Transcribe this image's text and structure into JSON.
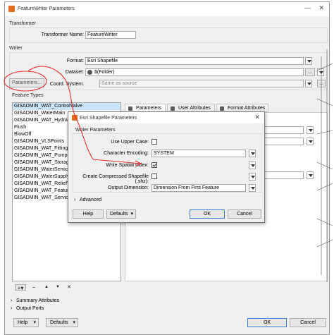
{
  "window": {
    "title": "FeatureWriter Parameters",
    "close_glyph": "✕",
    "min_glyph": "—"
  },
  "transformer": {
    "section_label": "Transformer",
    "name_label": "Transformer Name:",
    "name_value": "FeatureWriter"
  },
  "writer": {
    "section_label": "Writer",
    "format_label": "Format:",
    "format_value": "Esri Shapefile",
    "dataset_label": "Dataset:",
    "dataset_value": "$(Folder)",
    "dataset_browse": "...",
    "coord_label": "Coord. System:",
    "coord_placeholder": "Same as source",
    "parameters_button": "Parameters..."
  },
  "feature_types": {
    "section_label": "Feature Types",
    "items": [
      "GISADMIN_WAT_ControlValve",
      "GISADMIN_WaterMain",
      "GISADMIN_WAT_Hydrant",
      "Flush",
      "BlowOff",
      "GISADMIN_VLSPoints",
      "GISADMIN_WAT_Fittings",
      "GISADMIN_WAT_Pumps",
      "GISADMIN_WAT_Storage",
      "GISADMIN_WaterService",
      "GISADMIN_WaterSupply",
      "GISADMIN_WAT_ReliefV",
      "GISADMIN_WAT_Feature",
      "GISADMIN_WAT_Service"
    ],
    "toolbar": {
      "add": "+▾",
      "remove": "−",
      "up": "▲",
      "down": "▼",
      "clear": "✕"
    }
  },
  "tabs": [
    {
      "label": "Parameters",
      "icon": "gear-icon"
    },
    {
      "label": "User Attributes",
      "icon": "table-icon"
    },
    {
      "label": "Format Attributes",
      "icon": "table-icon"
    }
  ],
  "bottom": {
    "summary_attributes": "Summary Attributes",
    "output_ports": "Output Ports",
    "help": "Help",
    "defaults": "Defaults",
    "ok": "OK",
    "cancel": "Cancel"
  },
  "dialog": {
    "title": "Esri Shapefile Parameters",
    "group_label": "Writer Parameters",
    "fields": {
      "upper_case_label": "Use Upper Case:",
      "upper_case_checked": false,
      "encoding_label": "Character Encoding:",
      "encoding_value": "SYSTEM",
      "spatial_index_label": "Write Spatial Index:",
      "spatial_index_checked": true,
      "compressed_label": "Create Compressed Shapefile (.shz):",
      "compressed_checked": false,
      "output_dim_label": "Output Dimension:",
      "output_dim_value": "Dimension From First Feature"
    },
    "advanced": "Advanced",
    "help": "Help",
    "defaults": "Defaults",
    "ok": "OK",
    "cancel": "Cancel",
    "close_glyph": "✕"
  },
  "colors": {
    "annotation": "#e8302c",
    "selection": "#cce4f7",
    "accent": "#3c7fd6"
  }
}
